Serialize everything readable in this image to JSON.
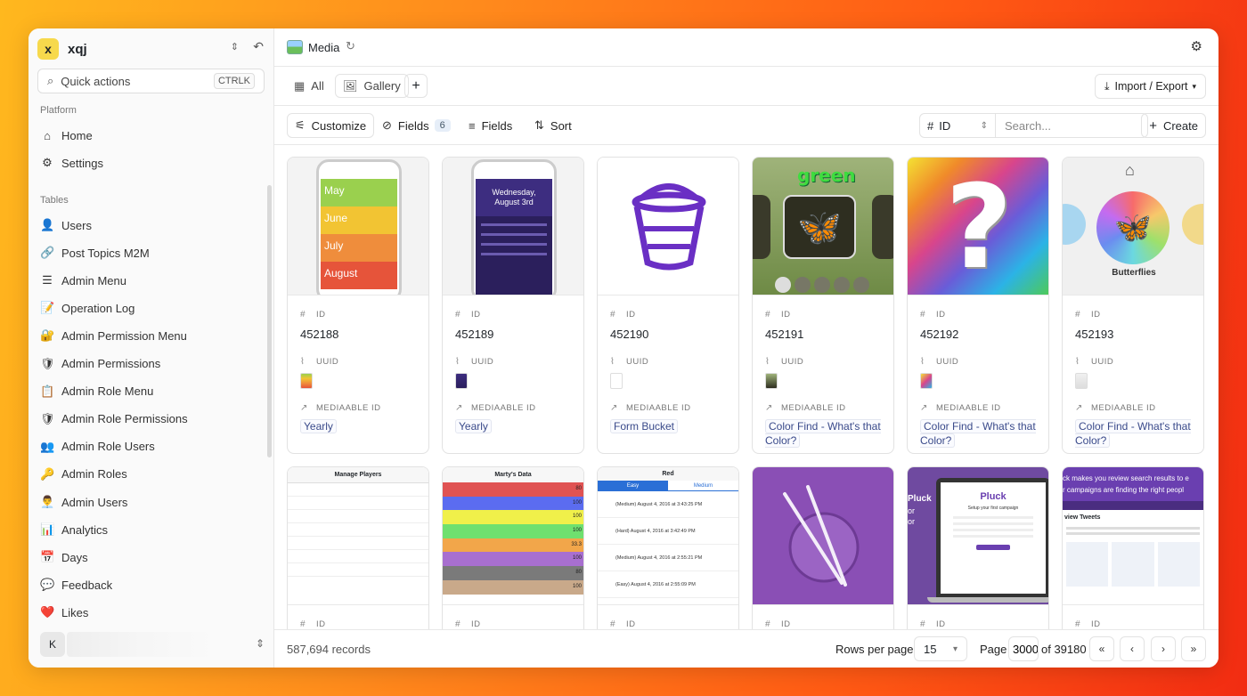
{
  "workspace": {
    "initial": "x",
    "name": "xqj"
  },
  "quick_actions": {
    "label": "Quick actions",
    "shortcut": "CTRLK"
  },
  "sidebar": {
    "platform_label": "Platform",
    "platform_items": [
      {
        "label": "Home",
        "icon": "home-icon"
      },
      {
        "label": "Settings",
        "icon": "gear-icon"
      }
    ],
    "tables_label": "Tables",
    "table_items": [
      {
        "label": "Users",
        "glyph": "👤"
      },
      {
        "label": "Post Topics M2M",
        "glyph": "🔗"
      },
      {
        "label": "Admin Menu",
        "glyph": "☰"
      },
      {
        "label": "Operation Log",
        "glyph": "📝"
      },
      {
        "label": "Admin Permission Menu",
        "glyph": "🔐"
      },
      {
        "label": "Admin Permissions",
        "glyph": "🛡"
      },
      {
        "label": "Admin Role Menu",
        "glyph": "📋"
      },
      {
        "label": "Admin Role Permissions",
        "glyph": "🛡"
      },
      {
        "label": "Admin Role Users",
        "glyph": "👥"
      },
      {
        "label": "Admin Roles",
        "glyph": "🔑"
      },
      {
        "label": "Admin Users",
        "glyph": "👨‍💼"
      },
      {
        "label": "Analytics",
        "glyph": "📊"
      },
      {
        "label": "Days",
        "glyph": "📅"
      },
      {
        "label": "Feedback",
        "glyph": "💬"
      },
      {
        "label": "Likes",
        "glyph": "❤️"
      }
    ],
    "user_initial": "K"
  },
  "topbar": {
    "title": "Media"
  },
  "views": {
    "all_label": "All",
    "gallery_label": "Gallery",
    "import_export_label": "Import / Export"
  },
  "toolbar": {
    "customize_label": "Customize",
    "hidden_fields_label": "Fields",
    "hidden_fields_count": "6",
    "fields_label": "Fields",
    "sort_label": "Sort",
    "search_field": "ID",
    "search_placeholder": "Search...",
    "create_label": "Create"
  },
  "field_labels": {
    "id": "ID",
    "uuid": "UUID",
    "mediaable_id": "MEDIAABLE ID"
  },
  "cards": [
    {
      "id": "452188",
      "mediaable": "Yearly"
    },
    {
      "id": "452189",
      "mediaable": "Yearly"
    },
    {
      "id": "452190",
      "mediaable": "Form Bucket"
    },
    {
      "id": "452191",
      "mediaable": "Color Find - What's that Color?"
    },
    {
      "id": "452192",
      "mediaable": "Color Find - What's that Color?"
    },
    {
      "id": "452193",
      "mediaable": "Color Find - What's that Color?"
    }
  ],
  "thumb_text": {
    "months": [
      "May",
      "June",
      "July",
      "August"
    ],
    "calendar_date": "Wednesday, August 3rd",
    "green_word": "green",
    "butterflies": "Butterflies",
    "manage_players": "Manage Players",
    "martys_data": "Marty's Data",
    "red": "Red",
    "easy": "Easy",
    "medium": "Medium",
    "red_rows": [
      "(Medium) August 4, 2016 at 3:43:25 PM",
      "(Hard) August 4, 2016 at 3:42:49 PM",
      "(Medium) August 4, 2016 at 2:55:21 PM",
      "(Easy) August 4, 2016 at 2:55:09 PM"
    ],
    "marty_values": [
      "80",
      "100",
      "100",
      "100",
      "33.3",
      "100",
      "80",
      "100"
    ],
    "pluck": "Pluck",
    "pluck_setup": "Setup your first campaign",
    "review_banner": "ck makes you review search results to e",
    "review_banner2": "r campaigns are finding the right peopl",
    "review_tweets": "view Tweets"
  },
  "footer": {
    "records": "587,694 records",
    "rows_per_page_label": "Rows per page",
    "rows_per_page": "15",
    "page_label": "Page",
    "page_value": "3000",
    "of_label": "of 39180"
  },
  "colors": {
    "accent": "#3a4a8a",
    "brand_bg": "#ff7a1a"
  }
}
